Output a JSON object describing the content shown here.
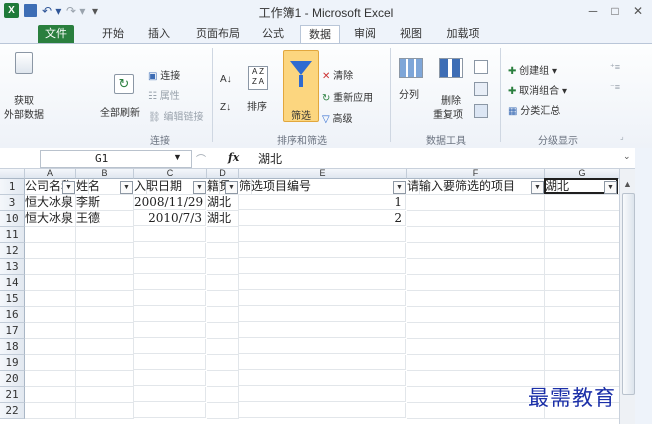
{
  "window": {
    "title": "工作簿1 - Microsoft Excel",
    "quick_access": {
      "undo": "↶ ▾",
      "redo": "↷ ▾",
      "customize": "▾"
    },
    "controls": {
      "minimize": "─",
      "restore": "□",
      "close": "✕"
    }
  },
  "tabs": [
    {
      "label": "文件"
    },
    {
      "label": "开始"
    },
    {
      "label": "插入"
    },
    {
      "label": "页面布局"
    },
    {
      "label": "公式"
    },
    {
      "label": "数据"
    },
    {
      "label": "审阅"
    },
    {
      "label": "视图"
    },
    {
      "label": "加载项"
    }
  ],
  "ribbon": {
    "get_data": {
      "line1": "获取",
      "line2": "外部数据"
    },
    "refresh_all": "全部刷新",
    "connections": "连接",
    "properties": "属性",
    "edit_links": "编辑链接",
    "group_connections": "连接",
    "sort_label": "排序",
    "filter_label": "筛选",
    "clear": "清除",
    "reapply": "重新应用",
    "advanced": "高级",
    "group_sort_filter": "排序和筛选",
    "text_to_columns": "分列",
    "remove_duplicates": {
      "line1": "删除",
      "line2": "重复项"
    },
    "group_data_tools": "数据工具",
    "group": "创建组",
    "ungroup": "取消组合",
    "subtotal": "分类汇总",
    "group_outline": "分级显示"
  },
  "formula_bar": {
    "cell_ref": "G1",
    "fx": "fx",
    "value": "湖北"
  },
  "columns": [
    "A",
    "B",
    "C",
    "D",
    "E",
    "F",
    "G"
  ],
  "rows": [
    {
      "num": "1",
      "cells": [
        "公司名称",
        "姓名",
        "入职日期",
        "籍贯",
        "筛选项目编号",
        "请输入要筛选的项目",
        "湖北"
      ]
    },
    {
      "num": "3",
      "cells": [
        "恒大冰泉",
        "李斯",
        "2008/11/29",
        "湖北",
        "1",
        "",
        ""
      ]
    },
    {
      "num": "10",
      "cells": [
        "恒大冰泉",
        "王德",
        "2010/7/3",
        "湖北",
        "2",
        "",
        ""
      ]
    },
    {
      "num": "11",
      "cells": [
        "",
        "",
        "",
        "",
        "",
        "",
        ""
      ]
    },
    {
      "num": "12",
      "cells": [
        "",
        "",
        "",
        "",
        "",
        "",
        ""
      ]
    },
    {
      "num": "13",
      "cells": [
        "",
        "",
        "",
        "",
        "",
        "",
        ""
      ]
    },
    {
      "num": "14",
      "cells": [
        "",
        "",
        "",
        "",
        "",
        "",
        ""
      ]
    },
    {
      "num": "15",
      "cells": [
        "",
        "",
        "",
        "",
        "",
        "",
        ""
      ]
    },
    {
      "num": "16",
      "cells": [
        "",
        "",
        "",
        "",
        "",
        "",
        ""
      ]
    },
    {
      "num": "17",
      "cells": [
        "",
        "",
        "",
        "",
        "",
        "",
        ""
      ]
    },
    {
      "num": "18",
      "cells": [
        "",
        "",
        "",
        "",
        "",
        "",
        ""
      ]
    },
    {
      "num": "19",
      "cells": [
        "",
        "",
        "",
        "",
        "",
        "",
        ""
      ]
    },
    {
      "num": "20",
      "cells": [
        "",
        "",
        "",
        "",
        "",
        "",
        ""
      ]
    },
    {
      "num": "21",
      "cells": [
        "",
        "",
        "",
        "",
        "",
        "",
        ""
      ]
    },
    {
      "num": "22",
      "cells": [
        "",
        "",
        "",
        "",
        "",
        "",
        ""
      ]
    }
  ],
  "watermark": "最需教育",
  "colors": {
    "file_tab": "#2a7f3e",
    "accent": "#2f5597",
    "selected_cell_border": "#1f1f1f"
  }
}
